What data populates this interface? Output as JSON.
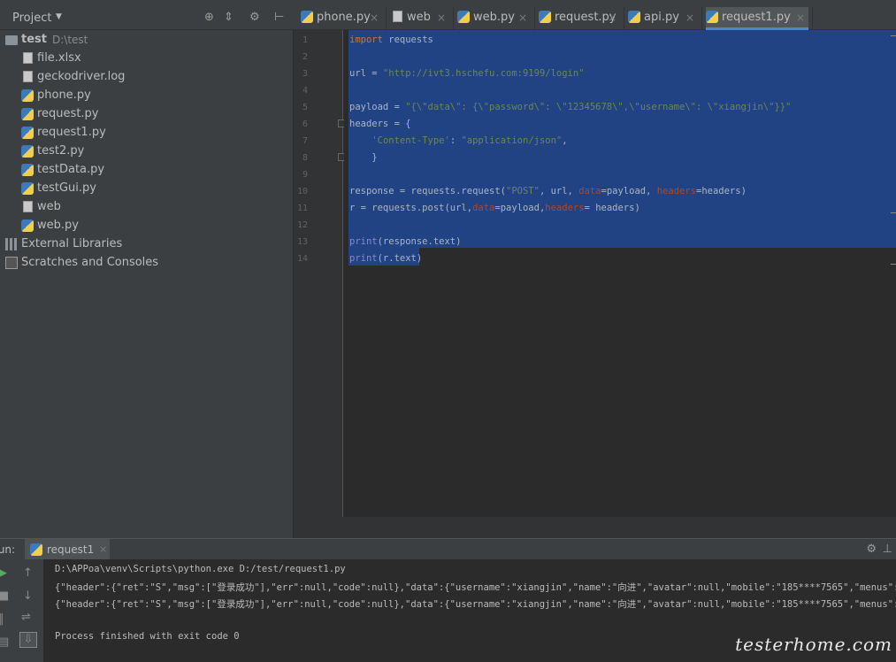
{
  "project_panel": {
    "title": "Project",
    "root": {
      "name": "test",
      "path": "D:\\test"
    },
    "files": [
      {
        "name": "file.xlsx",
        "icon": "file-icon"
      },
      {
        "name": "geckodriver.log",
        "icon": "file-icon"
      },
      {
        "name": "phone.py",
        "icon": "python-file-icon"
      },
      {
        "name": "request.py",
        "icon": "python-file-icon"
      },
      {
        "name": "request1.py",
        "icon": "python-file-icon"
      },
      {
        "name": "test2.py",
        "icon": "python-file-icon"
      },
      {
        "name": "testData.py",
        "icon": "python-file-icon"
      },
      {
        "name": "testGui.py",
        "icon": "python-file-icon"
      },
      {
        "name": "web",
        "icon": "file-icon"
      },
      {
        "name": "web.py",
        "icon": "python-file-icon"
      }
    ],
    "external_libraries": "External Libraries",
    "scratches": "Scratches and Consoles"
  },
  "tabs": [
    {
      "label": "phone.py",
      "active": false
    },
    {
      "label": "web",
      "active": false
    },
    {
      "label": "web.py",
      "active": false
    },
    {
      "label": "request.py",
      "active": false
    },
    {
      "label": "api.py",
      "active": false
    },
    {
      "label": "request1.py",
      "active": true
    }
  ],
  "tab_close": "×",
  "editor": {
    "line_numbers": [
      "1",
      "2",
      "3",
      "4",
      "5",
      "6",
      "7",
      "8",
      "9",
      "10",
      "11",
      "12",
      "13",
      "14"
    ],
    "code": [
      {
        "segments": [
          {
            "t": "import",
            "c": "kw"
          },
          {
            "t": " requests",
            "c": ""
          }
        ]
      },
      {
        "segments": []
      },
      {
        "segments": [
          {
            "t": "url = ",
            "c": ""
          },
          {
            "t": "\"http://ivt3.hschefu.com:9199/login\"",
            "c": "st"
          }
        ]
      },
      {
        "segments": []
      },
      {
        "segments": [
          {
            "t": "payload = ",
            "c": ""
          },
          {
            "t": "\"{\\\"data\\\": {\\\"password\\\": \\\"12345678\\\",\\\"username\\\": \\\"xiangjin\\\"}}\"",
            "c": "st"
          }
        ]
      },
      {
        "segments": [
          {
            "t": "headers = {",
            "c": ""
          }
        ]
      },
      {
        "segments": [
          {
            "t": "    ",
            "c": ""
          },
          {
            "t": "'Content-Type'",
            "c": "st"
          },
          {
            "t": ": ",
            "c": ""
          },
          {
            "t": "\"application/json\"",
            "c": "st"
          },
          {
            "t": ",",
            "c": ""
          }
        ]
      },
      {
        "segments": [
          {
            "t": "    }",
            "c": ""
          }
        ]
      },
      {
        "segments": []
      },
      {
        "segments": [
          {
            "t": "response = requests.request(",
            "c": ""
          },
          {
            "t": "\"POST\"",
            "c": "st"
          },
          {
            "t": ", url, ",
            "c": ""
          },
          {
            "t": "data",
            "c": "pm"
          },
          {
            "t": "=payload, ",
            "c": ""
          },
          {
            "t": "headers",
            "c": "pm"
          },
          {
            "t": "=headers)",
            "c": ""
          }
        ]
      },
      {
        "segments": [
          {
            "t": "r = requests.post(url,",
            "c": ""
          },
          {
            "t": "data",
            "c": "pm"
          },
          {
            "t": "=payload,",
            "c": ""
          },
          {
            "t": "headers",
            "c": "pm"
          },
          {
            "t": "= headers)",
            "c": ""
          }
        ]
      },
      {
        "segments": []
      },
      {
        "segments": [
          {
            "t": "print",
            "c": "bi"
          },
          {
            "t": "(response.text)",
            "c": ""
          }
        ]
      },
      {
        "segments": [
          {
            "t": "print",
            "c": "bi"
          },
          {
            "t": "(r.text)",
            "c": ""
          }
        ]
      }
    ]
  },
  "run_panel": {
    "label": "Run:",
    "tab": "request1",
    "lines": [
      "D:\\APPoa\\venv\\Scripts\\python.exe D:/test/request1.py",
      "{\"header\":{\"ret\":\"S\",\"msg\":[\"登录成功\"],\"err\":null,\"code\":null},\"data\":{\"username\":\"xiangjin\",\"name\":\"向进\",\"avatar\":null,\"mobile\":\"185****7565\",\"menus\":[{\"id\"",
      "{\"header\":{\"ret\":\"S\",\"msg\":[\"登录成功\"],\"err\":null,\"code\":null},\"data\":{\"username\":\"xiangjin\",\"name\":\"向进\",\"avatar\":null,\"mobile\":\"185****7565\",\"menus\":[{\"id\"",
      "",
      "Process finished with exit code 0"
    ]
  },
  "watermark": "testerhome.com"
}
